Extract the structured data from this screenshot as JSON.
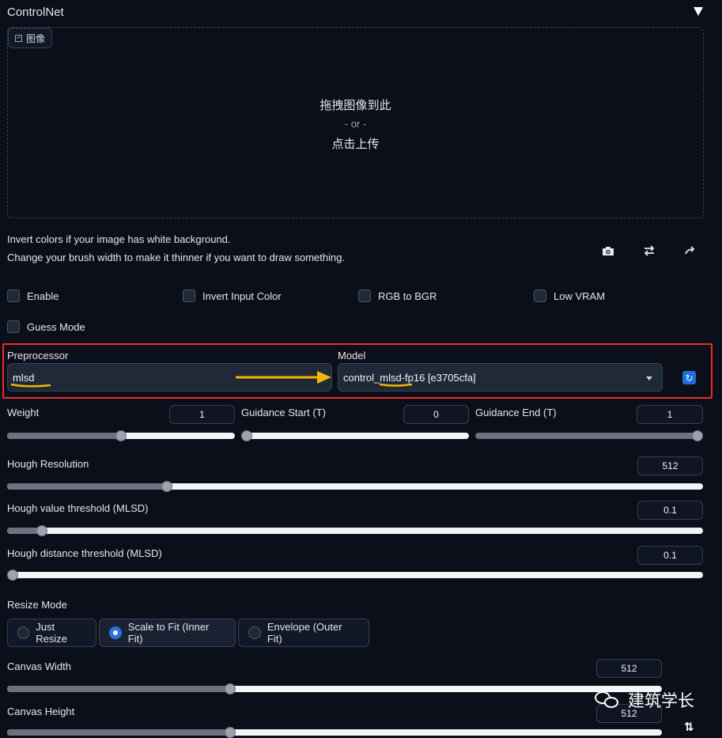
{
  "panel": {
    "title": "ControlNet"
  },
  "image": {
    "tab_label": "图像",
    "drop_text": "拖拽图像到此",
    "or_text": "- or -",
    "upload_text": "点击上传"
  },
  "hints": [
    "Invert colors if your image has white background.",
    "Change your brush width to make it thinner if you want to draw something."
  ],
  "tool_icons": [
    "camera-icon",
    "swap-icon",
    "rotate-icon"
  ],
  "options": {
    "enable": {
      "label": "Enable",
      "checked": false
    },
    "invert": {
      "label": "Invert Input Color",
      "checked": false
    },
    "rgb_bgr": {
      "label": "RGB to BGR",
      "checked": false
    },
    "low_vram": {
      "label": "Low VRAM",
      "checked": false
    },
    "guess": {
      "label": "Guess Mode",
      "checked": false
    }
  },
  "preprocessor": {
    "label": "Preprocessor",
    "value": "mlsd"
  },
  "model": {
    "label": "Model",
    "value": "control_mlsd-fp16 [e3705cfa]"
  },
  "sliders": {
    "weight": {
      "label": "Weight",
      "value": "1",
      "fraction": 0.5
    },
    "guidance_start": {
      "label": "Guidance Start (T)",
      "value": "0",
      "fraction": 0.0
    },
    "guidance_end": {
      "label": "Guidance End (T)",
      "value": "1",
      "fraction": 1.0
    },
    "hough_resolution": {
      "label": "Hough Resolution",
      "value": "512",
      "fraction": 0.23
    },
    "hough_value": {
      "label": "Hough value threshold (MLSD)",
      "value": "0.1",
      "fraction": 0.05
    },
    "hough_distance": {
      "label": "Hough distance threshold (MLSD)",
      "value": "0.1",
      "fraction": 0.005
    },
    "canvas_width": {
      "label": "Canvas Width",
      "value": "512",
      "fraction": 0.34
    },
    "canvas_height": {
      "label": "Canvas Height",
      "value": "512",
      "fraction": 0.34
    }
  },
  "resize_mode": {
    "label": "Resize Mode",
    "options": [
      "Just Resize",
      "Scale to Fit (Inner Fit)",
      "Envelope (Outer Fit)"
    ],
    "selected": "Scale to Fit (Inner Fit)"
  },
  "watermark": {
    "text": "建筑学长"
  },
  "colors": {
    "background": "#0b0f19",
    "highlight_frame": "#ef2b2b",
    "annotation_arrow": "#f5b400",
    "accent": "#2f6fe4"
  }
}
